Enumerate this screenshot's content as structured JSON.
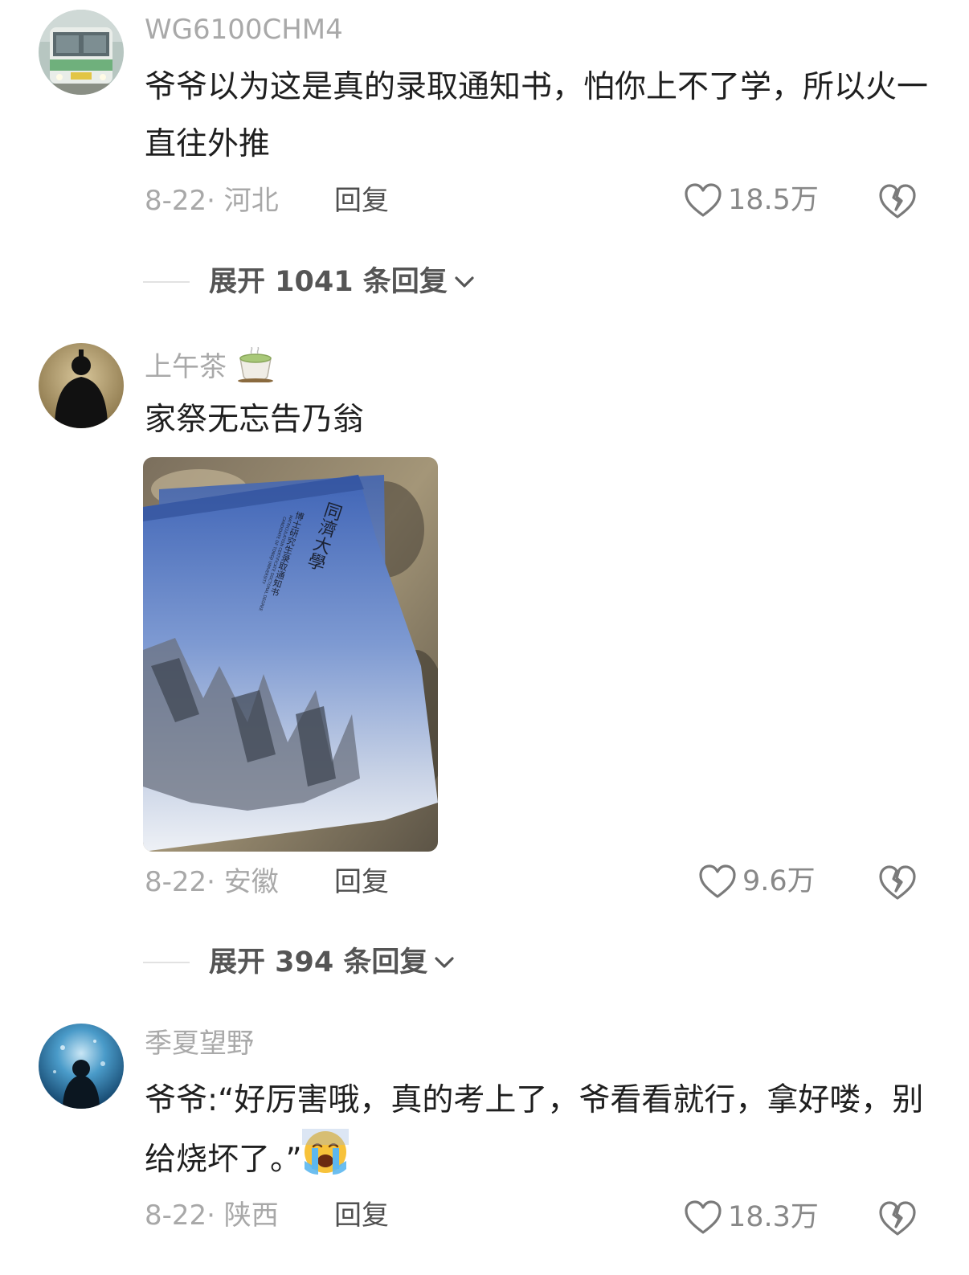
{
  "comments": [
    {
      "username": "WG6100CHM4",
      "text": "爷爷以为这是真的录取通知书，怕你上不了学，所以火一直往外推",
      "date": "8-22",
      "location": "河北",
      "reply_label": "回复",
      "likes": "18.5万",
      "expand_label": "展开 1041 条回复"
    },
    {
      "username": "上午茶",
      "username_emoji": "tea-emoji",
      "text": "家祭无忘告乃翁",
      "image": {
        "university_name": "同濟大學",
        "doc_title": "博士研究生录取通知书",
        "doc_subtitle_en_1": "MATRICULATION CERTIFICATE DOCTORAL DEGREE",
        "doc_subtitle_en_2": "CANDIDATE OF TONGJI UNIVERSITY"
      },
      "date": "8-22",
      "location": "安徽",
      "reply_label": "回复",
      "likes": "9.6万",
      "expand_label": "展开 394 条回复"
    },
    {
      "username": "季夏望野",
      "text": "爷爷:“好厉害哦，真的考上了，爷看看就行，拿好喽，别给烧坏了。”",
      "text_emoji": "crying-face-emoji",
      "date": "8-22",
      "location": "陕西",
      "reply_label": "回复",
      "likes": "18.3万"
    }
  ],
  "colors": {
    "username": "#a9a9a9",
    "content": "#1f1f1f",
    "meta": "#a8a8a8",
    "expand_text": "#555555"
  }
}
